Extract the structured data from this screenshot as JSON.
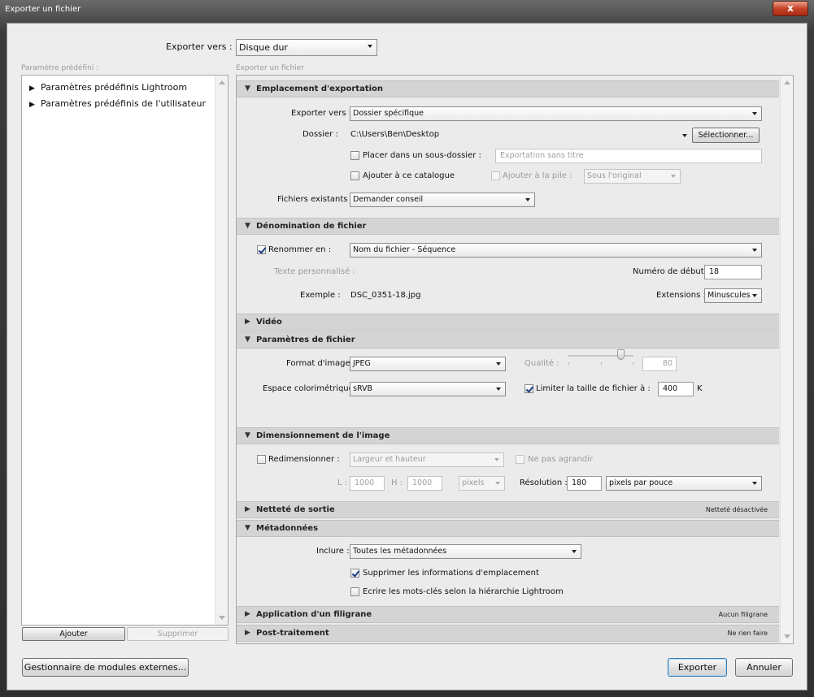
{
  "window": {
    "title": "Exporter un fichier",
    "close": "x"
  },
  "top": {
    "export_to_label": "Exporter vers :",
    "export_to_value": "Disque dur"
  },
  "left": {
    "header": "Paramètre prédéfini :",
    "items": [
      "Paramètres prédéfinis Lightroom",
      "Paramètres prédéfinis de l'utilisateur"
    ],
    "add": "Ajouter",
    "remove": "Supprimer"
  },
  "right": {
    "header": "Exporter un fichier"
  },
  "location": {
    "title": "Emplacement d'exportation",
    "export_to_label": "Exporter vers :",
    "export_to_value": "Dossier spécifique",
    "folder_label": "Dossier :",
    "folder_value": "C:\\Users\\Ben\\Desktop",
    "choose": "Sélectionner...",
    "subfolder_label": "Placer dans un sous-dossier :",
    "subfolder_placeholder": "Exportation sans titre",
    "add_catalog": "Ajouter à ce catalogue",
    "add_stack": "Ajouter à la pile :",
    "stack_value": "Sous l'original",
    "existing_label": "Fichiers existants :",
    "existing_value": "Demander conseil"
  },
  "naming": {
    "title": "Dénomination de fichier",
    "rename_label": "Renommer en :",
    "rename_value": "Nom du fichier - Séquence",
    "custom_label": "Texte personnalisé :",
    "start_label": "Numéro de début :",
    "start_value": "18",
    "example_label": "Exemple :",
    "example_value": "DSC_0351-18.jpg",
    "ext_label": "Extensions :",
    "ext_value": "Minuscules"
  },
  "video": {
    "title": "Vidéo"
  },
  "settings": {
    "title": "Paramètres de fichier",
    "format_label": "Format d'image :",
    "format_value": "JPEG",
    "quality_label": "Qualité :",
    "quality_value": "80",
    "quality_level": 80,
    "color_label": "Espace colorimétrique :",
    "color_value": "sRVB",
    "limit_label": "Limiter la taille de fichier à :",
    "limit_value": "400",
    "limit_unit": "K"
  },
  "sizing": {
    "title": "Dimensionnement de l'image",
    "resize_label": "Redimensionner :",
    "resize_value": "Largeur et hauteur",
    "no_enlarge": "Ne pas agrandir",
    "w_label": "L :",
    "w_value": "1000",
    "h_label": "H :",
    "h_value": "1000",
    "unit_value": "pixels",
    "res_label": "Résolution :",
    "res_value": "180",
    "res_unit": "pixels par pouce"
  },
  "sharpen": {
    "title": "Netteté de sortie",
    "status": "Netteté désactivée"
  },
  "metadata": {
    "title": "Métadonnées",
    "include_label": "Inclure :",
    "include_value": "Toutes les métadonnées",
    "remove_location": "Supprimer les informations d'emplacement",
    "hierarchy": "Ecrire les mots-clés selon la hiérarchie Lightroom"
  },
  "watermark": {
    "title": "Application d'un filigrane",
    "status": "Aucun filigrane"
  },
  "post": {
    "title": "Post-traitement",
    "status": "Ne rien faire"
  },
  "footer": {
    "plugins": "Gestionnaire de modules externes...",
    "export": "Exporter",
    "cancel": "Annuler"
  },
  "glyphs": {
    "expanded": "▼",
    "collapsed": "▶"
  }
}
